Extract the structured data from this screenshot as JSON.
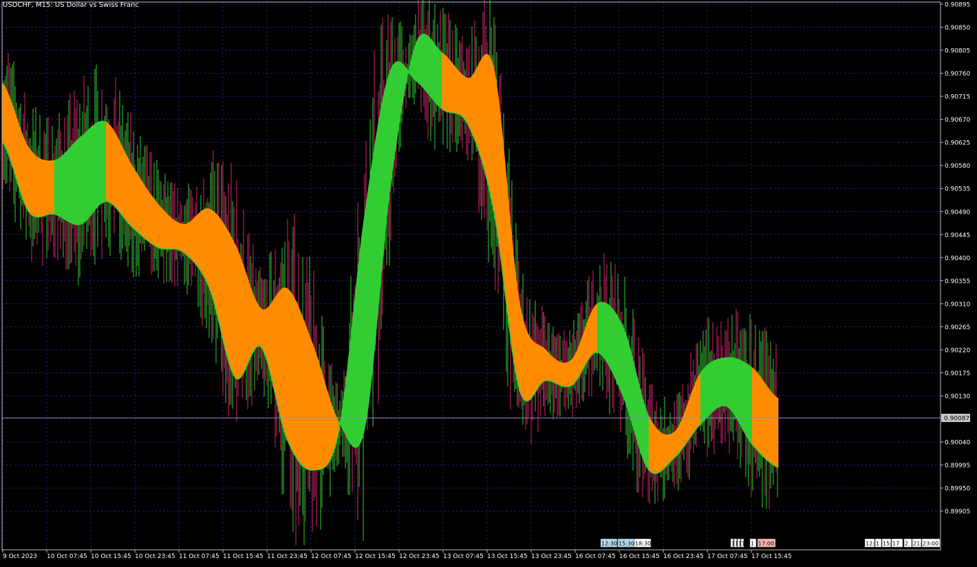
{
  "window": {
    "title": "USDCHF, M15:  US Dollar vs Swiss Franc"
  },
  "colors": {
    "background": "#000000",
    "grid": "#1c1c6e",
    "frame": "#c0c0c0",
    "band_up": "#32cd32",
    "band_down": "#ff8c00",
    "candle_up": "#32cd32",
    "candle_down": "#d4246b",
    "current_line": "#8a8fb5"
  },
  "chart_data": {
    "type": "line",
    "symbol": "USDCHF",
    "timeframe": "M15",
    "description": "US Dollar vs Swiss Franc",
    "ylim": [
      0.89875,
      0.90895
    ],
    "y_ticks": [
      0.90895,
      0.9085,
      0.90805,
      0.9076,
      0.90715,
      0.9067,
      0.90625,
      0.9058,
      0.90535,
      0.9049,
      0.90445,
      0.904,
      0.90355,
      0.9031,
      0.90265,
      0.9022,
      0.90175,
      0.9013,
      0.90085,
      0.9004,
      0.89995,
      0.8995,
      0.89905
    ],
    "y_tick_labels": [
      "0.90895",
      "0.90850",
      "0.90805",
      "0.90760",
      "0.90715",
      "0.90670",
      "0.90625",
      "0.90580",
      "0.90535",
      "0.90490",
      "0.90445",
      "0.90400",
      "0.90355",
      "0.90310",
      "0.90265",
      "0.90220",
      "0.90175",
      "0.90130",
      "",
      "0.90040",
      "0.89995",
      "0.89950",
      "0.89905"
    ],
    "x_tick_labels": [
      "9 Oct 2023",
      "10 Oct 07:45",
      "10 Oct 15:45",
      "10 Oct 23:45",
      "11 Oct 07:45",
      "11 Oct 15:45",
      "11 Oct 23:45",
      "12 Oct 07:45",
      "12 Oct 15:45",
      "12 Oct 23:45",
      "13 Oct 07:45",
      "13 Oct 15:45",
      "13 Oct 23:45",
      "16 Oct 07:45",
      "16 Oct 15:45",
      "16 Oct 23:45",
      "17 Oct 07:45",
      "17 Oct 15:45"
    ],
    "current_price": 0.90087,
    "current_price_label": "0.90087",
    "grid": true,
    "band": {
      "upper": [
        0.9074,
        0.90615,
        0.9059,
        0.90635,
        0.90665,
        0.9058,
        0.90505,
        0.90465,
        0.90495,
        0.90425,
        0.903,
        0.9034,
        0.9023,
        0.9008,
        0.90065,
        0.9054,
        0.9082,
        0.908,
        0.9075,
        0.9077,
        0.9031,
        0.9022,
        0.902,
        0.9031,
        0.90265,
        0.9009,
        0.9006,
        0.90175,
        0.90205,
        0.90185,
        0.90125
      ],
      "lower": [
        0.90625,
        0.9049,
        0.90485,
        0.90465,
        0.9051,
        0.9046,
        0.9042,
        0.9041,
        0.9034,
        0.90165,
        0.90225,
        0.90045,
        0.89985,
        0.9006,
        0.9048,
        0.90765,
        0.90745,
        0.9069,
        0.9066,
        0.9049,
        0.9014,
        0.9016,
        0.9015,
        0.90215,
        0.9013,
        0.89985,
        0.9001,
        0.90075,
        0.9011,
        0.90035,
        0.8999
      ],
      "trend": [
        "down",
        "down",
        "up",
        "up",
        "down",
        "down",
        "down",
        "down",
        "down",
        "down",
        "down",
        "down",
        "down",
        "up",
        "up",
        "up",
        "up",
        "down",
        "down",
        "down",
        "down",
        "down",
        "down",
        "up",
        "up",
        "down",
        "down",
        "up",
        "up",
        "down",
        "down"
      ]
    },
    "time_markers": [
      {
        "label": "12:30",
        "style": "blue"
      },
      {
        "label": "15:30",
        "style": "blue"
      },
      {
        "label": "18:30",
        "style": "white"
      },
      {
        "label": "1",
        "style": "white"
      },
      {
        "label": "1",
        "style": "white"
      },
      {
        "label": "1",
        "style": "white"
      },
      {
        "label": "1",
        "style": "white"
      },
      {
        "label": "1",
        "style": "white"
      },
      {
        "label": "17:00",
        "style": "red"
      },
      {
        "label": "12:",
        "style": "white"
      },
      {
        "label": "1",
        "style": "white"
      },
      {
        "label": "15:",
        "style": "white"
      },
      {
        "label": "17",
        "style": "white"
      },
      {
        "label": "2",
        "style": "white"
      },
      {
        "label": "21:",
        "style": "white"
      },
      {
        "label": "23:00",
        "style": "white"
      }
    ]
  }
}
